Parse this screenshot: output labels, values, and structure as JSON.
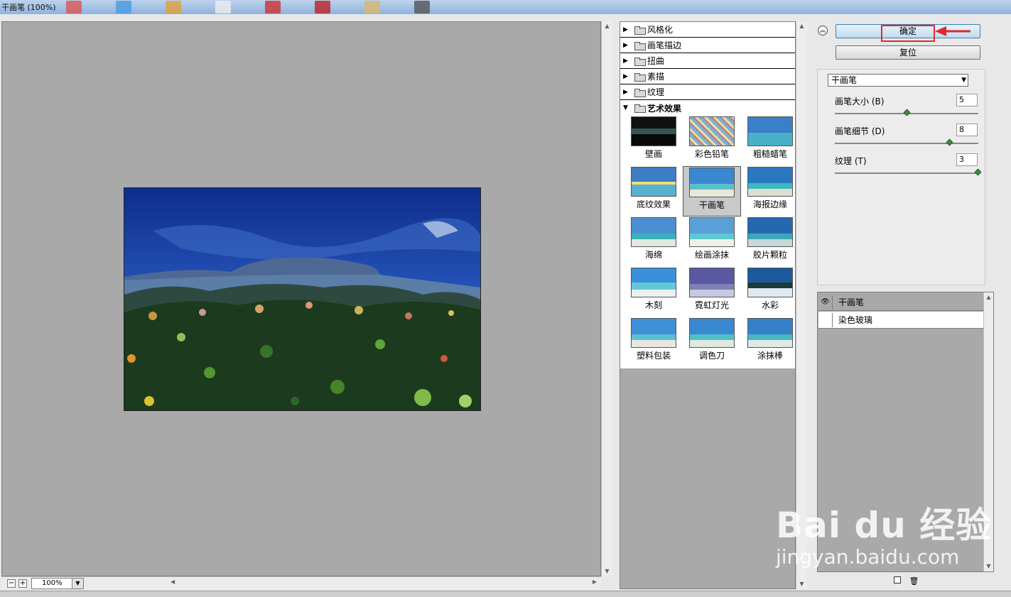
{
  "window": {
    "title": "干画笔 (100%)"
  },
  "preview": {
    "zoom_value": "100%",
    "zoom_out_label": "−",
    "zoom_in_label": "+"
  },
  "gallery": {
    "categories": [
      {
        "label": "风格化",
        "open": false
      },
      {
        "label": "画笔描边",
        "open": false
      },
      {
        "label": "扭曲",
        "open": false
      },
      {
        "label": "素描",
        "open": false
      },
      {
        "label": "纹理",
        "open": false
      },
      {
        "label": "艺术效果",
        "open": true
      }
    ],
    "filters": [
      {
        "label": "壁画"
      },
      {
        "label": "彩色铅笔"
      },
      {
        "label": "粗糙蜡笔"
      },
      {
        "label": "底纹效果"
      },
      {
        "label": "干画笔",
        "selected": true
      },
      {
        "label": "海报边缘"
      },
      {
        "label": "海绵"
      },
      {
        "label": "绘画涂抹"
      },
      {
        "label": "胶片颗粒"
      },
      {
        "label": "木刻"
      },
      {
        "label": "霓虹灯光"
      },
      {
        "label": "水彩"
      },
      {
        "label": "塑料包装"
      },
      {
        "label": "调色刀"
      },
      {
        "label": "涂抹棒"
      }
    ]
  },
  "buttons": {
    "ok": "确定",
    "reset": "复位"
  },
  "settings": {
    "filter_select": "干画笔",
    "params": [
      {
        "label": "画笔大小 (B)",
        "value": "5",
        "level": 0.5
      },
      {
        "label": "画笔细节 (D)",
        "value": "8",
        "level": 0.8
      },
      {
        "label": "纹理 (T)",
        "value": "3",
        "level": 1.0
      }
    ]
  },
  "layers": [
    {
      "label": "干画笔",
      "visible": true
    },
    {
      "label": "染色玻璃",
      "visible": false
    }
  ],
  "watermark": {
    "brand": "Bai du 经验",
    "url": "jingyan.baidu.com"
  },
  "colors": {
    "accent_red": "#e3292a",
    "panel_gray": "#a9a9a9"
  }
}
